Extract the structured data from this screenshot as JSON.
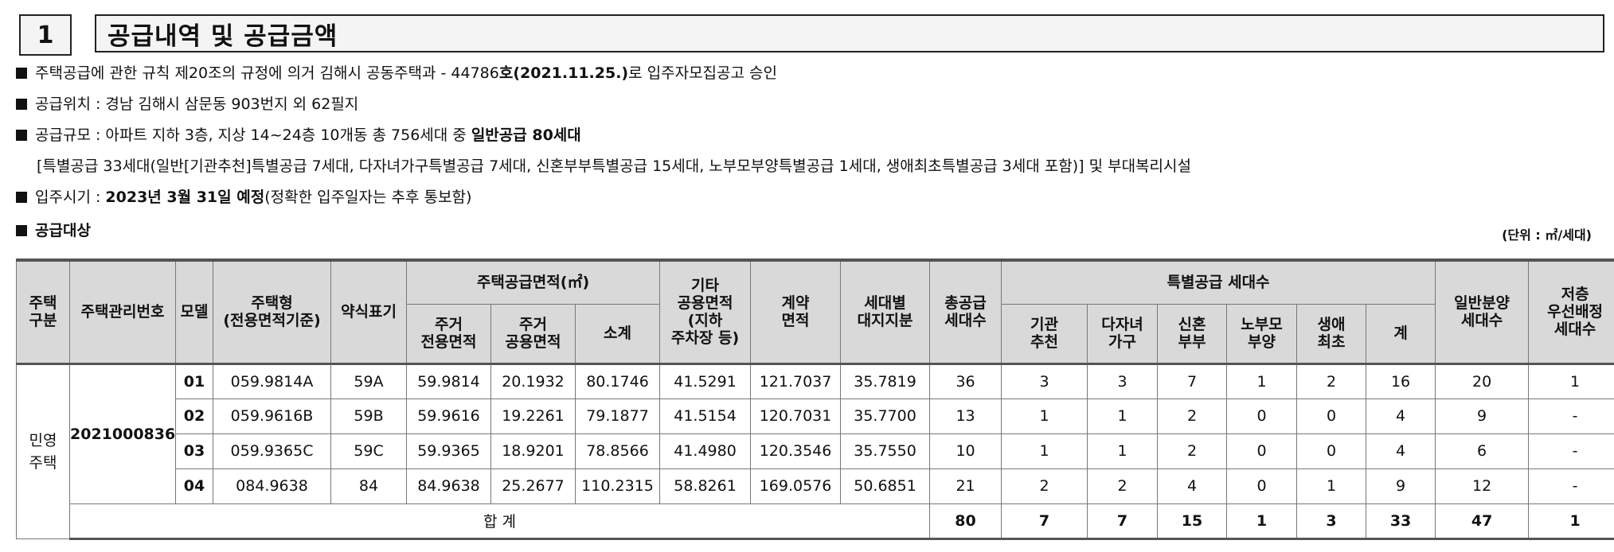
{
  "header": {
    "number": "1",
    "title": "공급내역 및 공급금액"
  },
  "lines": {
    "l1_pre": "주택공급에 관한 규칙 제20조의 규정에 의거 김해시 공동주택과 -  44786",
    "l1_bold": "호(2021.11.25.)",
    "l1_post": "로 입주자모집공고 승인",
    "l2": "공급위치 : 경남 김해시 삼문동 903번지 외 62필지",
    "l3_pre": "공급규모 : 아파트 지하 3층, 지상 14~24층 10개동 총 756세대 중 ",
    "l3_bold": "일반공급 80세대",
    "l4": "[특별공급 33세대(일반[기관추천]특별공급 7세대, 다자녀가구특별공급 7세대, 신혼부부특별공급 15세대, 노부모부양특별공급 1세대, 생애최초특별공급 3세대 포함)] 및 부대복리시설",
    "l5_pre": "입주시기 : ",
    "l5_bold": "2023년 3월 31일 예정",
    "l5_post": "(정확한 입주일자는 추후 통보함)",
    "l6": "공급대상"
  },
  "unit": "(단위 : ㎡/세대)",
  "table": {
    "headers": {
      "type": "주택\n구분",
      "mgmt_no": "주택관리번호",
      "model": "모델",
      "house_type": "주택형\n(전용면적기준)",
      "short": "약식표기",
      "supply_area": "주택공급면적(㎡)",
      "res_exclusive": "주거\n전용면적",
      "res_common": "주거\n공용면적",
      "subtotal": "소계",
      "other_common": "기타\n공용면적\n(지하\n주차장 등)",
      "contract_area": "계약\n면적",
      "land_share": "세대별\n대지지분",
      "total_units": "총공급\n세대수",
      "special": "특별공급 세대수",
      "sp_agency": "기관\n추천",
      "sp_multi": "다자녀\n가구",
      "sp_newlywed": "신혼\n부부",
      "sp_elderly": "노부모\n부양",
      "sp_first": "생애\n최초",
      "sp_sum": "계",
      "general": "일반분양\n세대수",
      "low_floor": "저층\n우선배정\n세대수"
    },
    "house_type_label": "민영\n주택",
    "mgmt_no": "2021000836",
    "rows": [
      {
        "model": "01",
        "house_type": "059.9814A",
        "short": "59A",
        "res_exclusive": "59.9814",
        "res_common": "20.1932",
        "subtotal": "80.1746",
        "other_common": "41.5291",
        "contract_area": "121.7037",
        "land_share": "35.7819",
        "total_units": "36",
        "sp_agency": "3",
        "sp_multi": "3",
        "sp_newlywed": "7",
        "sp_elderly": "1",
        "sp_first": "2",
        "sp_sum": "16",
        "general": "20",
        "low_floor": "1"
      },
      {
        "model": "02",
        "house_type": "059.9616B",
        "short": "59B",
        "res_exclusive": "59.9616",
        "res_common": "19.2261",
        "subtotal": "79.1877",
        "other_common": "41.5154",
        "contract_area": "120.7031",
        "land_share": "35.7700",
        "total_units": "13",
        "sp_agency": "1",
        "sp_multi": "1",
        "sp_newlywed": "2",
        "sp_elderly": "0",
        "sp_first": "0",
        "sp_sum": "4",
        "general": "9",
        "low_floor": "-"
      },
      {
        "model": "03",
        "house_type": "059.9365C",
        "short": "59C",
        "res_exclusive": "59.9365",
        "res_common": "18.9201",
        "subtotal": "78.8566",
        "other_common": "41.4980",
        "contract_area": "120.3546",
        "land_share": "35.7550",
        "total_units": "10",
        "sp_agency": "1",
        "sp_multi": "1",
        "sp_newlywed": "2",
        "sp_elderly": "0",
        "sp_first": "0",
        "sp_sum": "4",
        "general": "6",
        "low_floor": "-"
      },
      {
        "model": "04",
        "house_type": "084.9638",
        "short": "84",
        "res_exclusive": "84.9638",
        "res_common": "25.2677",
        "subtotal": "110.2315",
        "other_common": "58.8261",
        "contract_area": "169.0576",
        "land_share": "50.6851",
        "total_units": "21",
        "sp_agency": "2",
        "sp_multi": "2",
        "sp_newlywed": "4",
        "sp_elderly": "0",
        "sp_first": "1",
        "sp_sum": "9",
        "general": "12",
        "low_floor": "-"
      }
    ],
    "total": {
      "label": "합 계",
      "total_units": "80",
      "sp_agency": "7",
      "sp_multi": "7",
      "sp_newlywed": "15",
      "sp_elderly": "1",
      "sp_first": "3",
      "sp_sum": "33",
      "general": "47",
      "low_floor": "1"
    }
  }
}
